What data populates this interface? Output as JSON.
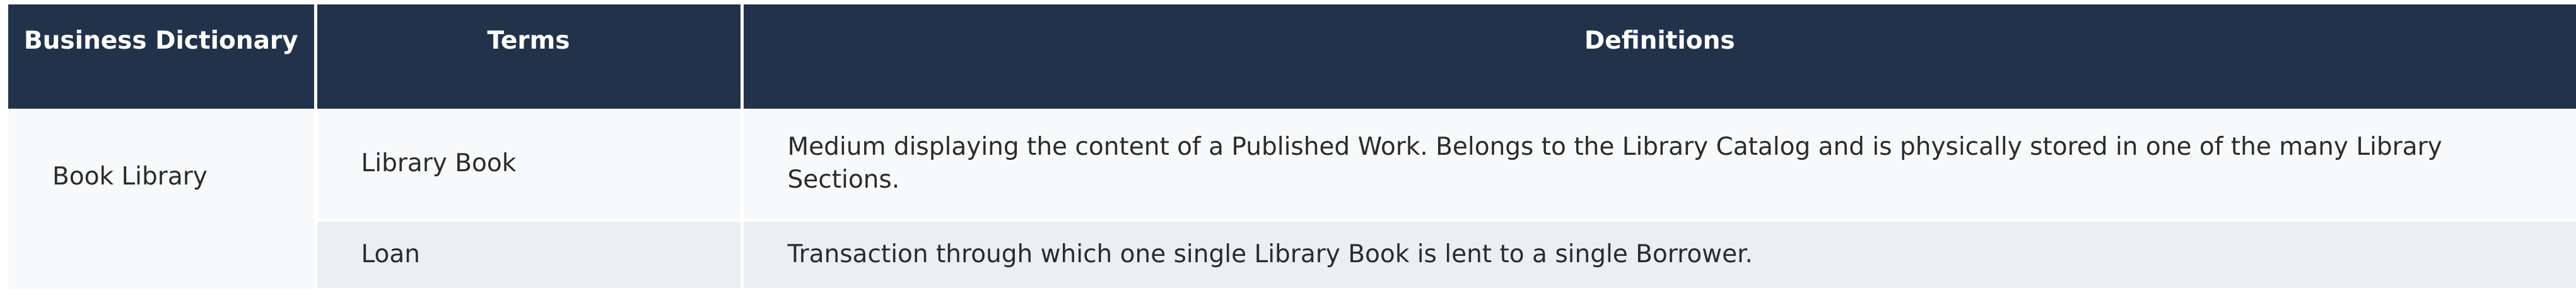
{
  "table": {
    "headers": [
      "Business Dictionary",
      "Terms",
      "Definitions"
    ],
    "dictionary": "Book Library",
    "rows": [
      {
        "term": "Library Book",
        "definition": "Medium displaying the content of a Published Work. Belongs to the Library Catalog and is physically stored in one of the many Library Sections."
      },
      {
        "term": "Loan",
        "definition": "Transaction through which one single Library Book is lent to a single Borrower."
      }
    ],
    "colors": {
      "header_bg": "#22324b",
      "header_text": "#ffffff",
      "row_light": "#f7f9fb",
      "row_alt": "#eceff1"
    }
  }
}
